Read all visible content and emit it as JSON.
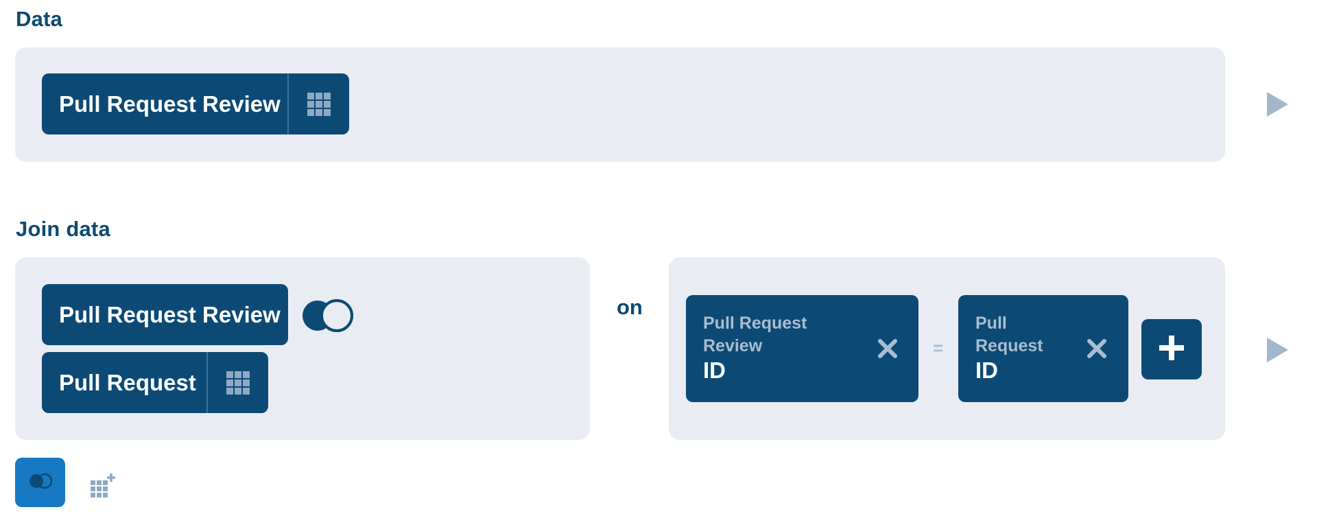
{
  "sections": {
    "data_title": "Data",
    "join_title": "Join data"
  },
  "data_step": {
    "table_label": "Pull Request Review",
    "table_icon": "grid-icon"
  },
  "join_step": {
    "left_table": "Pull Request Review",
    "join_type_icon": "venn-join-icon",
    "right_table": "Pull Request",
    "right_table_icon": "grid-icon",
    "on_label": "on",
    "condition": {
      "left": {
        "table": "Pull Request Review",
        "column": "ID"
      },
      "operator": "=",
      "right": {
        "table": "Pull Request",
        "column": "ID"
      }
    },
    "add_condition_icon": "plus-icon"
  },
  "toolbar": {
    "join_button_icon": "venn-join-icon",
    "add_data_icon": "grid-add-icon"
  },
  "colors": {
    "pill_bg": "#0c4a75",
    "panel_bg": "#e9ecf3",
    "accent_blue": "#1778c4",
    "muted_text": "#a9bdd0"
  }
}
